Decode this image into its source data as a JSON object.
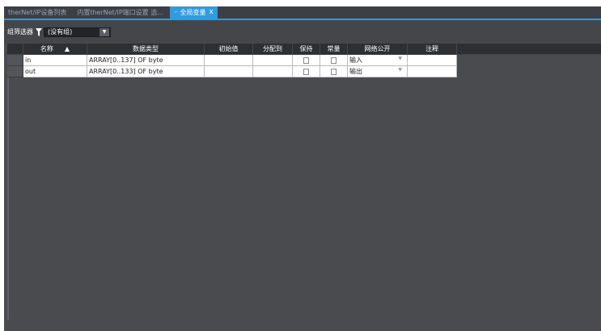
{
  "tabs": [
    {
      "label": "therNet/IP设备列表",
      "active": false
    },
    {
      "label": "内置therNet/IP端口设置 选...",
      "active": false
    },
    {
      "label": "全局变量",
      "active": true,
      "close": "x"
    }
  ],
  "filter": {
    "label": "组筛选器",
    "value": "(没有组)"
  },
  "table": {
    "columns": {
      "name": "名称",
      "type": "数据类型",
      "init": "初始值",
      "assign": "分配到",
      "retain": "保持",
      "const": "常量",
      "network": "网络公开",
      "comment": "注释"
    },
    "rows": [
      {
        "name": "in",
        "type": "ARRAY[0..137] OF byte",
        "network": "输入"
      },
      {
        "name": "out",
        "type": "ARRAY[0..133] OF byte",
        "network": "输出"
      }
    ]
  },
  "colors": {
    "accent": "#2f9be0",
    "workspace": "#4a4b4f",
    "header": "#2e2f33"
  }
}
